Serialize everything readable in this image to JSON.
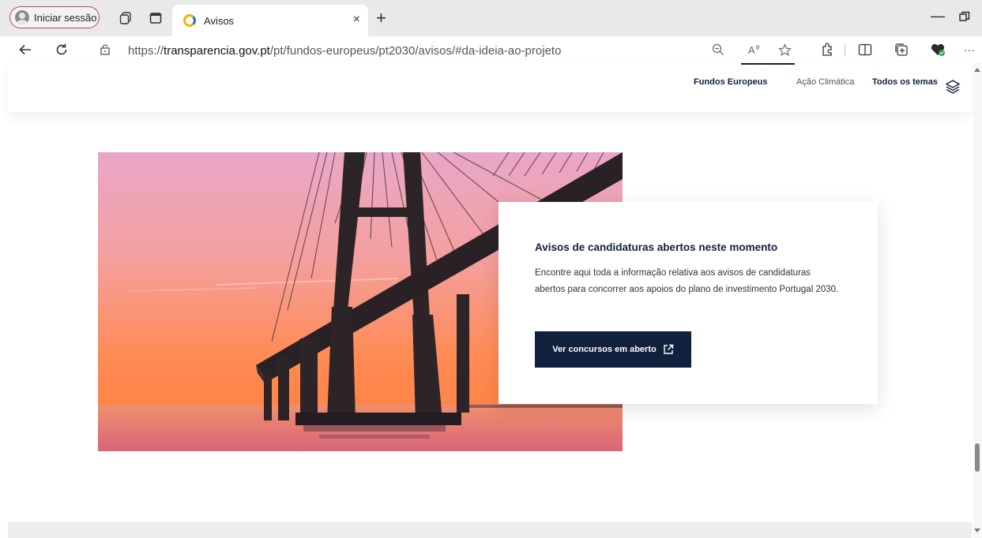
{
  "browser": {
    "profile_label": "Iniciar sessão",
    "tab_title": "Avisos",
    "url_prefix": "https://",
    "url_host": "transparencia.gov.pt",
    "url_path": "/pt/fundos-europeus/pt2030/avisos/#da-ideia-ao-projeto",
    "close_glyph": "×",
    "new_tab_glyph": "+",
    "minimize_glyph": "—",
    "more_glyph": "···"
  },
  "header": {
    "nav": {
      "fundos": "Fundos Europeus",
      "acao": "Ação Climática",
      "todos": "Todos os temas"
    }
  },
  "card": {
    "title": "Avisos de candidaturas abertos neste momento",
    "text": "Encontre aqui toda a informação relativa aos avisos de candidaturas abertos para concorrer aos apoios do plano de investimento Portugal 2030.",
    "button_label": "Ver concursos em aberto"
  },
  "colors": {
    "navy": "#11203d",
    "sky_top": "#e8a8c4",
    "sky_bottom": "#ff8a4a"
  }
}
